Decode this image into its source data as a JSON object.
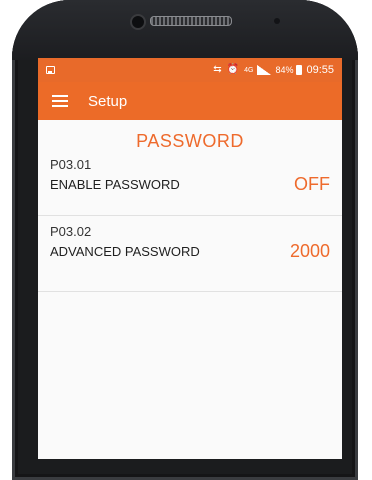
{
  "status_bar": {
    "battery_pct": "84%",
    "time": "09:55",
    "network": "4G"
  },
  "app_bar": {
    "title": "Setup"
  },
  "section": {
    "title": "PASSWORD"
  },
  "settings": [
    {
      "code": "P03.01",
      "label": "ENABLE PASSWORD",
      "value": "OFF"
    },
    {
      "code": "P03.02",
      "label": "ADVANCED PASSWORD",
      "value": "2000"
    }
  ],
  "colors": {
    "accent": "#ec6b28",
    "status_bar": "#e86a2a",
    "value_text": "#ee6a2c"
  }
}
